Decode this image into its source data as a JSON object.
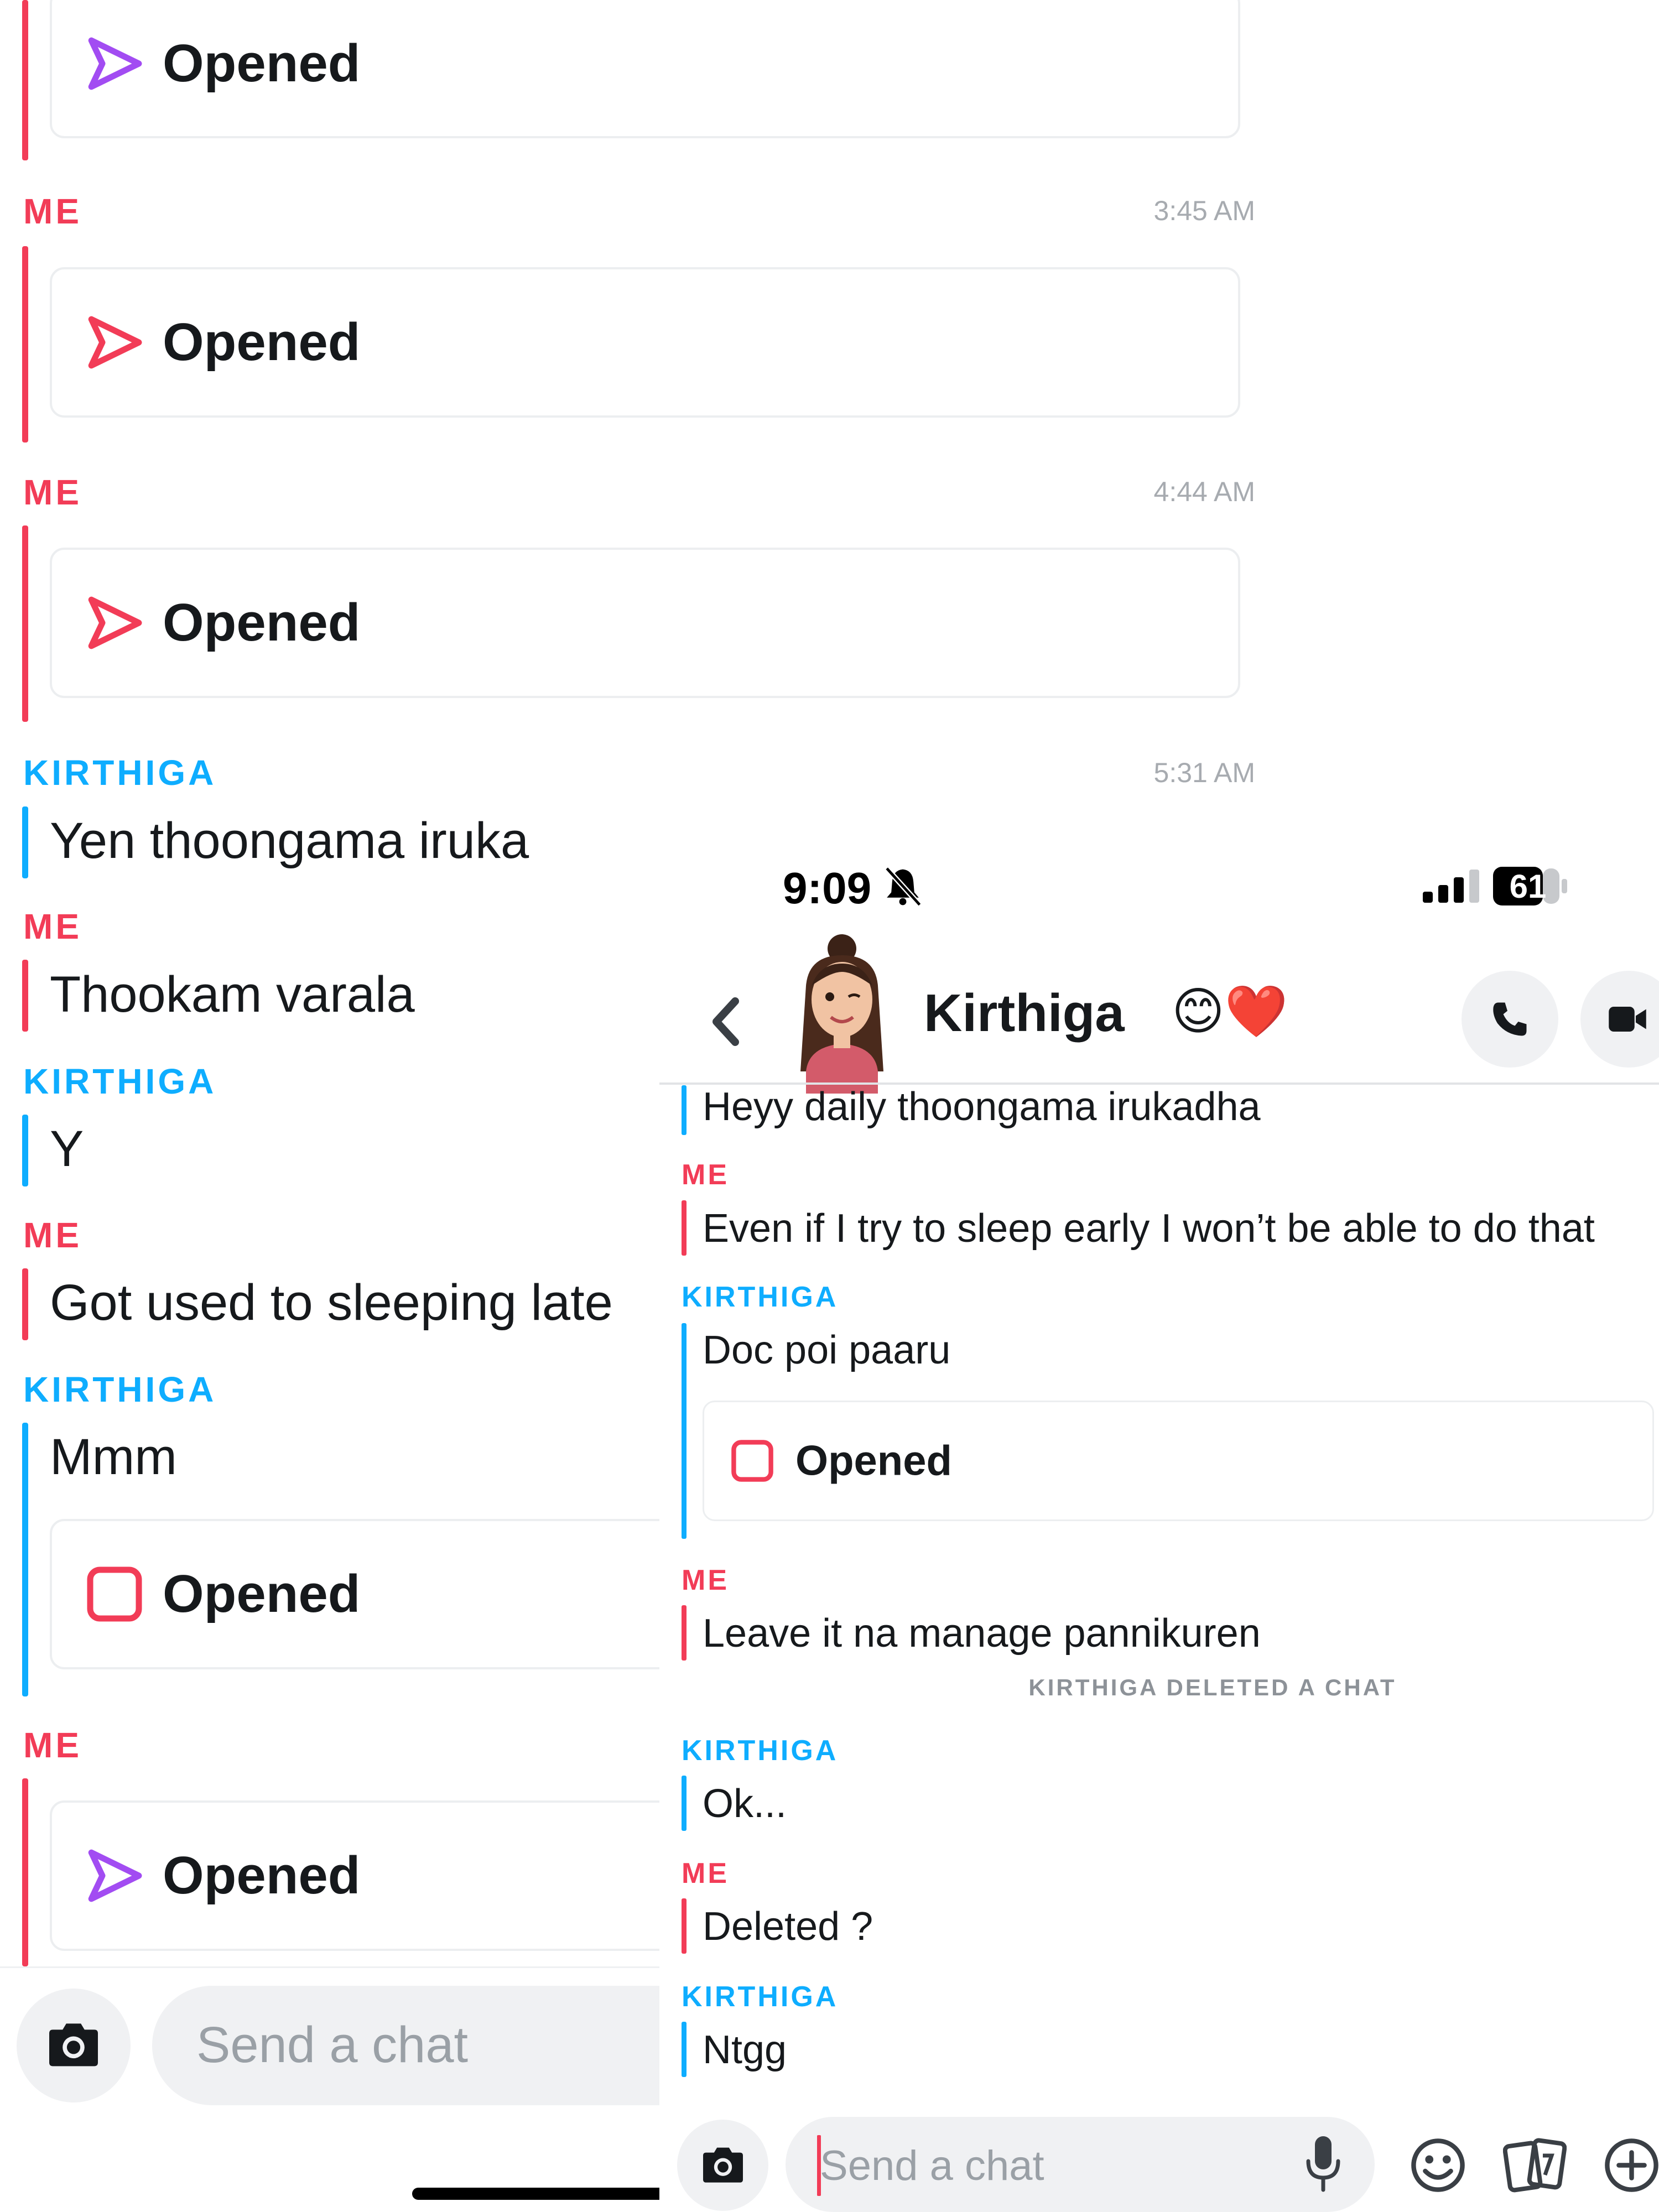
{
  "colors": {
    "me": "#f23c57",
    "her": "#0eadff",
    "purple_icon": "#a24cf2",
    "red_icon": "#f23c57"
  },
  "background_chat": {
    "messages": [
      {
        "sender": "",
        "time": "",
        "card": {
          "label": "Opened",
          "icon": "purple-send-arrow-icon"
        }
      },
      {
        "sender": "ME",
        "time": "3:45 AM",
        "card": {
          "label": "Opened",
          "icon": "red-send-arrow-icon"
        }
      },
      {
        "sender": "ME",
        "time": "4:44 AM",
        "card": {
          "label": "Opened",
          "icon": "red-send-arrow-icon"
        }
      },
      {
        "sender": "KIRTHIGA",
        "time": "5:31 AM",
        "text": "Yen thoongama iruka"
      },
      {
        "sender": "ME",
        "text": "Thookam varala"
      },
      {
        "sender": "KIRTHIGA",
        "text": "Y"
      },
      {
        "sender": "ME",
        "text": "Got used to sleeping late"
      },
      {
        "sender": "KIRTHIGA",
        "text": "Mmm",
        "card": {
          "label": "Opened",
          "icon": "red-square-snap-icon"
        }
      },
      {
        "sender": "ME",
        "card": {
          "label": "Opened",
          "icon": "purple-send-arrow-icon"
        }
      }
    ],
    "input_placeholder": "Send a chat"
  },
  "overlay_chat": {
    "status_bar": {
      "time": "9:09",
      "battery": "61"
    },
    "header": {
      "name": "Kirthiga",
      "name_emoji": "😊❤️"
    },
    "messages": [
      {
        "sender": "",
        "text": "Heyy daily thoongama irukadha"
      },
      {
        "sender": "ME",
        "text": "Even if I try to sleep early I won’t be able to do that"
      },
      {
        "sender": "KIRTHIGA",
        "text": "Doc poi paaru",
        "card": {
          "label": "Opened",
          "icon": "red-square-snap-icon"
        }
      },
      {
        "sender": "ME",
        "text": "Leave it na manage pannikuren"
      },
      {
        "sender": "KIRTHIGA",
        "text": "Ok..."
      },
      {
        "sender": "ME",
        "text": "Deleted ?"
      },
      {
        "sender": "KIRTHIGA",
        "text": "Ntgg"
      }
    ],
    "deleted_notice": "KIRTHIGA DELETED A CHAT",
    "input_placeholder": "Send a chat"
  }
}
